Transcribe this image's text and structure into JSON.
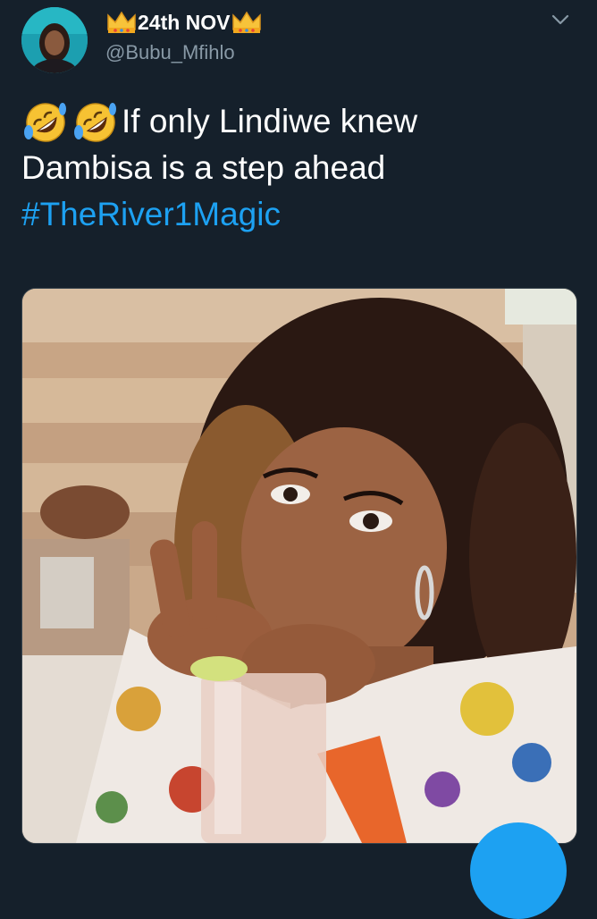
{
  "tweet": {
    "display_name": "24th NOV",
    "handle": "@Bubu_Mfihlo",
    "text_line1": "If only Lindiwe knew",
    "text_line2": "Dambisa is a step ahead",
    "hashtag": "#TheRiver1Magic",
    "emojis": [
      "rolling-on-floor-laughing",
      "rolling-on-floor-laughing"
    ],
    "name_decorations": [
      "crown-emoji",
      "crown-emoji"
    ]
  },
  "icons": {
    "menu": "chevron-down-icon",
    "compose": "compose-fab"
  },
  "colors": {
    "background": "#15202b",
    "secondary_text": "#8899a6",
    "link": "#1da1f2",
    "border": "#38444d"
  }
}
